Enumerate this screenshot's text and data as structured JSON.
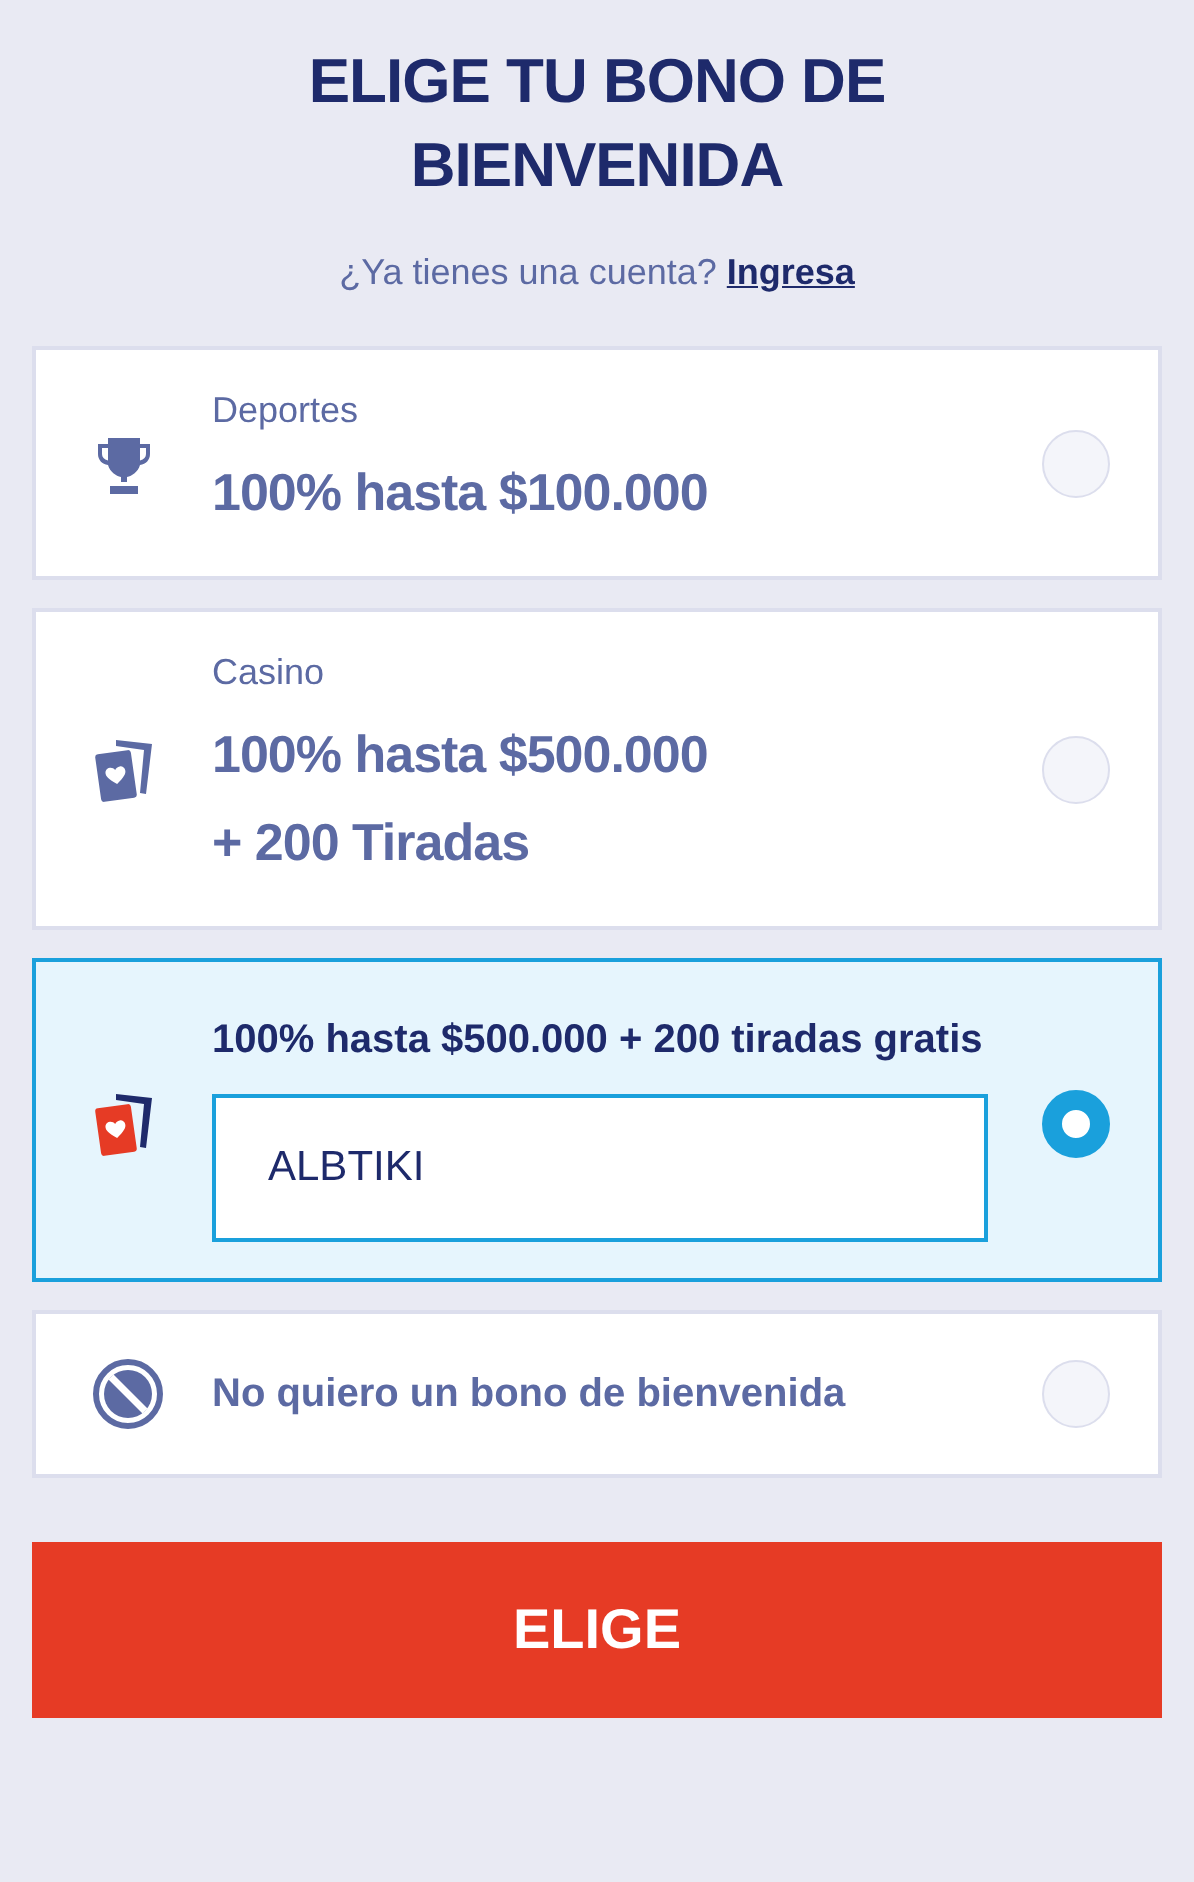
{
  "heading": "ELIGE TU BONO DE BIENVENIDA",
  "login_prompt": {
    "text": "¿Ya tienes una cuenta?",
    "link": "Ingresa"
  },
  "options": [
    {
      "kind": "trophy",
      "category": "Deportes",
      "title": "100% hasta $100.000",
      "selected": false
    },
    {
      "kind": "cards",
      "category": "Casino",
      "title": "100% hasta $500.000\n+ 200 Tiradas",
      "selected": false
    },
    {
      "kind": "cards",
      "title": "100% hasta $500.000 + 200 tiradas gratis",
      "code": "ALBTIKI",
      "selected": true
    },
    {
      "kind": "none",
      "title": "No quiero un bono de bienvenida",
      "selected": false
    }
  ],
  "submit_button": "ELIGE"
}
